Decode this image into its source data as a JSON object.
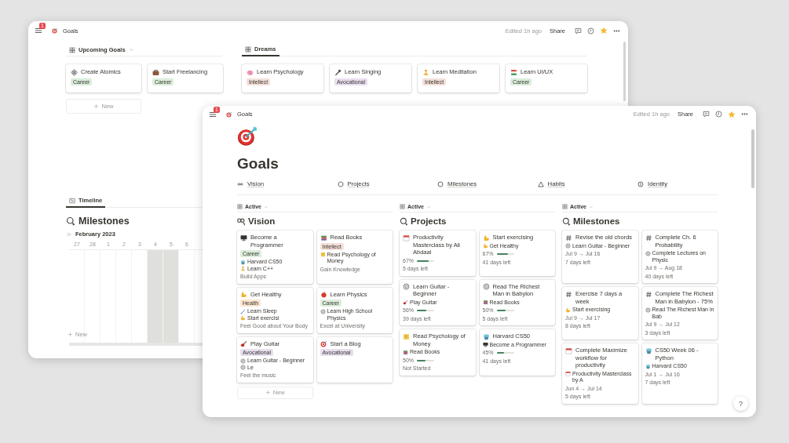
{
  "back_window": {
    "header": {
      "badge": "1",
      "title": "Goals",
      "edited": "Edited 1h ago",
      "share": "Share"
    },
    "upcoming": {
      "view": "Upcoming Goals",
      "cards": [
        {
          "title": "Create Atomics",
          "tag": {
            "text": "Career",
            "color": "#dbeddb"
          }
        },
        {
          "title": "Start Freelancing",
          "tag": {
            "text": "Career",
            "color": "#dbeddb"
          }
        }
      ],
      "new": "New"
    },
    "dreams": {
      "tab": "Dreams",
      "cards": [
        {
          "title": "Learn Psychology",
          "tag": {
            "text": "Intellect",
            "color": "#f4dfd9"
          }
        },
        {
          "title": "Learn Singing",
          "tag": {
            "text": "Avocational",
            "color": "#e8deee"
          }
        },
        {
          "title": "Learn Meditation",
          "tag": {
            "text": "Intellect",
            "color": "#f4dfd9"
          }
        },
        {
          "title": "Learn UI/UX",
          "tag": {
            "text": "Career",
            "color": "#dbeddb"
          }
        }
      ]
    },
    "timeline": {
      "tab": "Timeline",
      "heading": "Milestones",
      "month": "February 2023",
      "days": [
        {
          "label": "27",
          "weekend": false
        },
        {
          "label": "28",
          "weekend": false
        },
        {
          "label": "1",
          "weekend": false
        },
        {
          "label": "2",
          "weekend": false
        },
        {
          "label": "3",
          "weekend": false
        },
        {
          "label": "4",
          "weekend": true
        },
        {
          "label": "5",
          "weekend": true
        },
        {
          "label": "6",
          "weekend": false
        }
      ],
      "new": "New"
    }
  },
  "front_window": {
    "header": {
      "badge": "1",
      "title": "Goals",
      "edited": "Edited 1h ago",
      "share": "Share"
    },
    "title": "Goals",
    "nav": [
      {
        "label": "Vision"
      },
      {
        "label": "Projects"
      },
      {
        "label": "Milestones"
      },
      {
        "label": "Habits"
      },
      {
        "label": "Identity"
      }
    ],
    "columns": [
      {
        "view": "Active",
        "heading": "Vision",
        "new": "New",
        "cards": [
          {
            "title": "Become a Programmer",
            "tag": {
              "text": "Career",
              "color": "#dbeddb"
            },
            "relations": [
              "Harvard CS50",
              "Learn C++"
            ],
            "note": "Build Apps"
          },
          {
            "title": "Read Books",
            "tag": {
              "text": "Intellect",
              "color": "#f4dfd9"
            },
            "relations": [
              "Read Psychology of Money"
            ],
            "note": "Gain Knowledge"
          },
          {
            "title": "Get Healthy",
            "tag": {
              "text": "Health",
              "color": "#fbe4d0"
            },
            "relations": [
              "Learn Sleep",
              "Start exercisi"
            ],
            "note": "Feel Good about Your Body"
          },
          {
            "title": "Learn Physics",
            "tag": {
              "text": "Career",
              "color": "#dbeddb"
            },
            "relations": [
              "Learn High School Physics"
            ],
            "note": "Excel at University"
          },
          {
            "title": "Play Guitar",
            "tag": {
              "text": "Avocational",
              "color": "#e8deee"
            },
            "relations": [
              "Learn Guitar - Beginner",
              "Le"
            ],
            "note": "Feel the music"
          },
          {
            "title": "Start a Blog",
            "tag": {
              "text": "Avocational",
              "color": "#e8deee"
            }
          }
        ]
      },
      {
        "view": "Active",
        "heading": "Projects",
        "cards": [
          {
            "title": "Productivity Masterclass by Ali Abdaal",
            "percent": "67%",
            "level": 0.67,
            "footer": "5 days left"
          },
          {
            "title": "Start exercising",
            "relations": [
              "Get Healthy"
            ],
            "percent": "67%",
            "level": 0.67,
            "footer": "41 days left"
          },
          {
            "title": "Learn Guitar - Beginner",
            "relations": [
              "Play Guitar"
            ],
            "percent": "56%",
            "level": 0.56,
            "footer": "39 days left"
          },
          {
            "title": "Read The Richest Man in Babylon",
            "relations": [
              "Read Books"
            ],
            "percent": "50%",
            "level": 0.5,
            "footer": "5 days left"
          },
          {
            "title": "Read Psychology of Money",
            "relations": [
              "Read Books"
            ],
            "percent": "50%",
            "level": 0.5,
            "footer": "Not Started"
          },
          {
            "title": "Harvard CS50",
            "relations": [
              "Become a Programmer"
            ],
            "percent": "45%",
            "level": 0.45,
            "footer": "41 days left"
          }
        ]
      },
      {
        "view": "Active",
        "heading": "Milestones",
        "cards": [
          {
            "title": "Revise the old chords",
            "relations": [
              "Learn Guitar - Beginner"
            ],
            "dates": "Jul 9 → Jul 16",
            "footer": "7 days left"
          },
          {
            "title": "Complete Ch. 6 Probability",
            "relations": [
              "Complete Lectures on Physic"
            ],
            "dates": "Jul 9 → Aug 18",
            "footer": "40 days left"
          },
          {
            "title": "Exercise 7 days a week",
            "relations": [
              "Start exercising"
            ],
            "dates": "Jul 9 → Jul 17",
            "footer": "8 days left"
          },
          {
            "title": "Complete The Richest Man in Babylon - 75%",
            "relations": [
              "Read The Richest Man in Bab"
            ],
            "dates": "Jul 9 → Jul 12",
            "footer": "3 days left"
          },
          {
            "title": "Complete Maximize workflow for productivity",
            "relations": [
              "Productivity Masterclass by A"
            ],
            "dates": "Jun 4 → Jul 14",
            "footer": "5 days left"
          },
          {
            "title": "CS50 Week 06 - Python",
            "relations": [
              "Harvard CS50"
            ],
            "dates": "Jul 1 → Jul 16",
            "footer": "7 days left"
          }
        ]
      }
    ],
    "help": "?"
  }
}
